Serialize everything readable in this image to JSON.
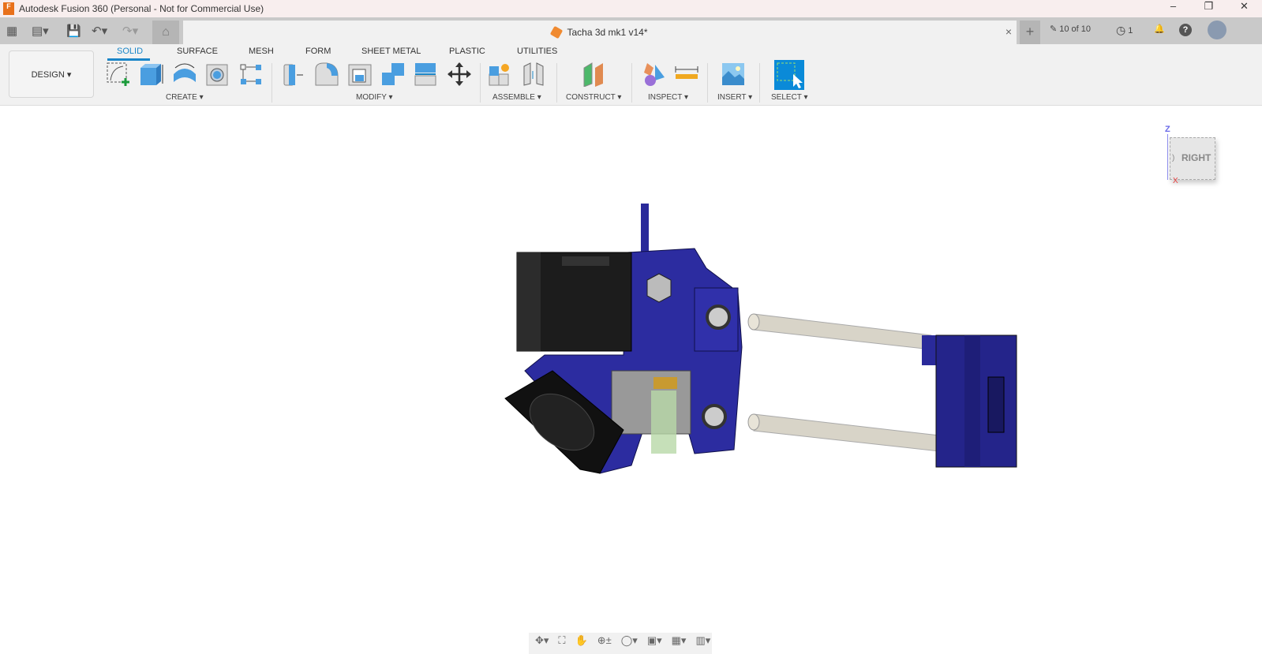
{
  "window": {
    "title": "Autodesk Fusion 360 (Personal - Not for Commercial Use)",
    "minimize": "–",
    "maximize": "❐",
    "close": "✕"
  },
  "quick_access": {
    "grid": "▦",
    "file": "▤▾",
    "save": "💾",
    "undo": "↶▾",
    "redo": "↷▾",
    "home": "⌂"
  },
  "document_tab": {
    "title": "Tacha 3d mk1 v14*",
    "close": "×"
  },
  "status": {
    "new_tab": "+",
    "versions": "10 of 10",
    "jobs": "1",
    "jobs_icon": "◷",
    "notification_icon": "🔔",
    "help": "?"
  },
  "workspace": {
    "label": "DESIGN ▾"
  },
  "tabs": [
    "SOLID",
    "SURFACE",
    "MESH",
    "FORM",
    "SHEET METAL",
    "PLASTIC",
    "UTILITIES"
  ],
  "active_tab": "SOLID",
  "groups": {
    "create": "CREATE ▾",
    "modify": "MODIFY ▾",
    "assemble": "ASSEMBLE ▾",
    "construct": "CONSTRUCT ▾",
    "inspect": "INSPECT ▾",
    "insert": "INSERT ▾",
    "select": "SELECT ▾"
  },
  "viewcube": {
    "face": "RIGHT",
    "axis_z": "Z",
    "axis_x": "X",
    "side": ")"
  },
  "navbar": {
    "orbit": "✥▾",
    "look": "⛶",
    "pan": "✋",
    "zoom": "⊕±",
    "fit": "◯▾",
    "display": "▣▾",
    "grid": "▦▾",
    "viewports": "▥▾"
  },
  "colors": {
    "accent": "#1a86c8",
    "part_blue": "#2a2a9a",
    "motor": "#1c1c1c",
    "rod": "#d8d4c8"
  }
}
